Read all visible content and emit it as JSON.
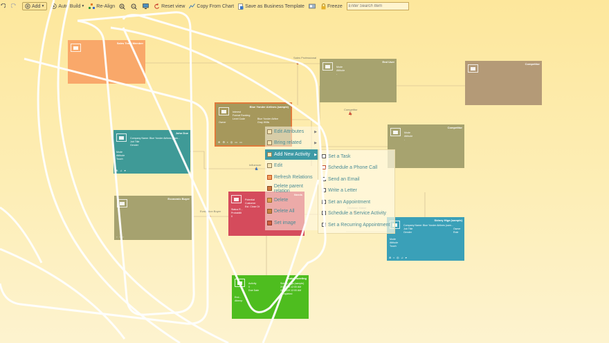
{
  "toolbar": {
    "add_label": "Add",
    "auto_build_label": "Auto Build",
    "realign_label": "Re-Align",
    "reset_view_label": "Reset view",
    "copy_chart_label": "Copy From Chart",
    "save_template_label": "Save as Business Template",
    "freeze_label": "Freeze",
    "search_placeholder": "Enter Search Item"
  },
  "links": {
    "label_1": "Sales Professional",
    "label_2": "Competitor",
    "label_3": "Influencer",
    "label_4": "Evaluation Buyer",
    "label_5": "Decision Maker"
  },
  "nodes": {
    "sales_team": {
      "title": "Sales Team Member"
    },
    "end_user": {
      "title": "End User",
      "fields": [
        "Mode",
        "Attitude",
        "-"
      ]
    },
    "competitor_top": {
      "title": "Competitor"
    },
    "blue_yonder_center": {
      "title": "Blue Yonder Airlines (sample)",
      "fields": [
        "Interest",
        "Formal Ranking",
        "Level Code"
      ],
      "fields2": [
        "Blue Yonder Airline",
        "Gray Willis"
      ],
      "footer": "Owner"
    },
    "john_doe": {
      "title": "John Doe",
      "fields": [
        "Company Name: Blue Yonder Airlines (sam...",
        "Job Title",
        "Gender"
      ],
      "fields3": [
        "Mode",
        "Attitude",
        "Touch"
      ]
    },
    "competitor_right": {
      "title": "Competitor",
      "fields": [
        "Mode",
        "Attitude",
        "-"
      ]
    },
    "economic_buyer": {
      "title": "Economic Buyer"
    },
    "red_node": {
      "title": "Needs",
      "fields": [
        "Potential",
        "Customer",
        "Est. Close Dt"
      ],
      "fields3": [
        "Status R...",
        "Probabilit",
        "0"
      ]
    },
    "sidney_higa": {
      "title": "Sidney Higa (sample)",
      "fields": [
        "Company Name: Blue Yonder Airlines (sam...",
        "Job Title",
        "Gender"
      ],
      "fields2": [
        "Owner",
        "Role"
      ],
      "fields3": [
        "Mode",
        "Attitude",
        "Touch"
      ]
    },
    "sales_meeting": {
      "title": "sales meeting",
      "fields": [
        "Activity",
        "0",
        "Due Date"
      ],
      "fields2": [
        "Sidney Higa (sample)",
        "2/1/2019 12:00 AM",
        "2/1/2019 12:00 AM",
        "Completed"
      ],
      "fields3": [
        "End...",
        "Attemp"
      ]
    }
  },
  "context_menu": {
    "items": [
      {
        "label": "Edit Attributes",
        "has_sub": true
      },
      {
        "label": "Bring related",
        "has_sub": true
      },
      {
        "label": "Add New Activity",
        "has_sub": true
      },
      {
        "label": "Edit",
        "has_sub": false
      },
      {
        "label": "Refresh Relations",
        "has_sub": false
      },
      {
        "label": "Delete parent relation",
        "has_sub": false
      },
      {
        "label": "Delete",
        "has_sub": false
      },
      {
        "label": "Delete All",
        "has_sub": false
      },
      {
        "label": "Set image",
        "has_sub": false
      }
    ]
  },
  "submenu": {
    "items": [
      {
        "label": "Set a Task"
      },
      {
        "label": "Schedule a Phone Call"
      },
      {
        "label": "Send an Email"
      },
      {
        "label": "Write a Letter"
      },
      {
        "label": "Set an Appointment"
      },
      {
        "label": "Schedule a Service Activity"
      },
      {
        "label": "Set a Recurring Appointment"
      }
    ]
  },
  "colors": {
    "background": "#fde79c",
    "accent_teal": "#3e9aa5",
    "node_orange": "#f7a064",
    "node_teal": "#3f9a98",
    "node_olive": "#a3a06c",
    "node_brown": "#b49a78",
    "node_red": "#d54a5b",
    "node_blue": "#3aa0b8",
    "node_green": "#4ebd1f"
  }
}
